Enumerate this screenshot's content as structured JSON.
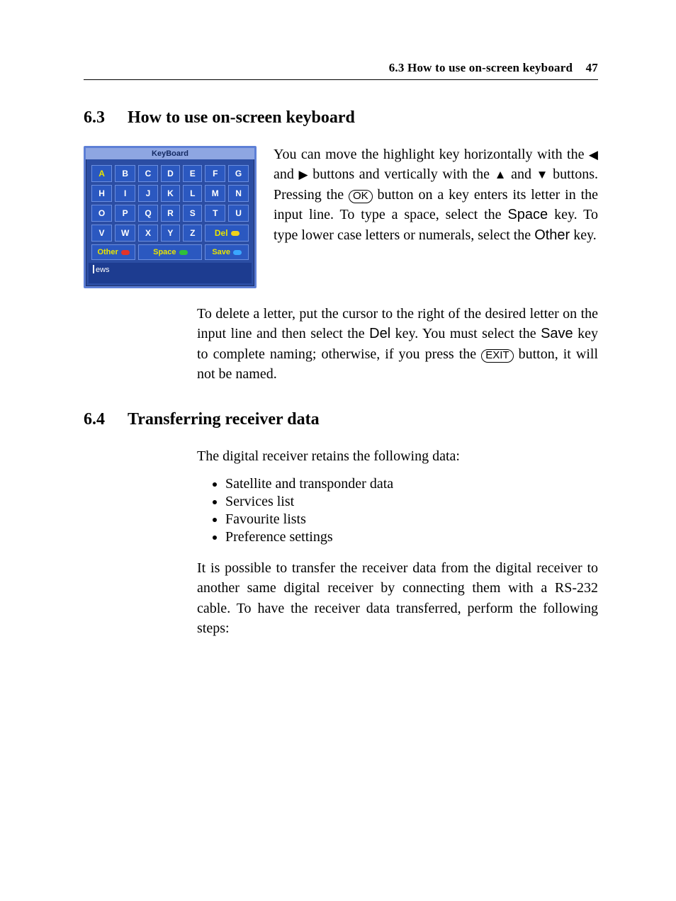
{
  "header": {
    "running_title": "6.3 How to use on-screen keyboard",
    "page_number": "47"
  },
  "section63": {
    "number": "6.3",
    "title": "How to use on-screen keyboard"
  },
  "keyboard": {
    "title": "KeyBoard",
    "rows": [
      [
        "A",
        "B",
        "C",
        "D",
        "E",
        "F",
        "G"
      ],
      [
        "H",
        "I",
        "J",
        "K",
        "L",
        "M",
        "N"
      ],
      [
        "O",
        "P",
        "Q",
        "R",
        "S",
        "T",
        "U"
      ],
      [
        "V",
        "W",
        "X",
        "Y",
        "Z"
      ]
    ],
    "del_label": "Del",
    "fn": {
      "other": "Other",
      "space": "Space",
      "save": "Save"
    },
    "input_value": "ews",
    "selected_key": "A"
  },
  "para63a": {
    "t1": "You can move the highlight key horizontally with the ",
    "t2": " and ",
    "t3": " buttons and vertically with the ",
    "t4": " and ",
    "t5": " buttons. Pressing the ",
    "ok": "OK",
    "t6": " button on a key enters its letter in the input line. To type a space, select the ",
    "space": "Space",
    "t7": " key. To type lower case letters or numerals, select the ",
    "other": "Other",
    "t8": " key."
  },
  "para63b": {
    "t1": "To delete a letter, put the cursor to the right of the desired letter on the input line and then select the ",
    "del": "Del",
    "t2": " key. You must select the ",
    "save": "Save",
    "t3": " key to complete naming; otherwise, if you press the ",
    "exit": "EXIT",
    "t4": " button, it will not be named."
  },
  "section64": {
    "number": "6.4",
    "title": "Transferring receiver data",
    "intro": "The digital receiver retains the following data:",
    "items": [
      "Satellite and transponder data",
      "Services list",
      "Favourite lists",
      "Preference settings"
    ],
    "outro": "It is possible to transfer the receiver data from the digital receiver to another same digital receiver by connecting them with a RS-232 cable. To have the receiver data transferred, perform the following steps:"
  }
}
